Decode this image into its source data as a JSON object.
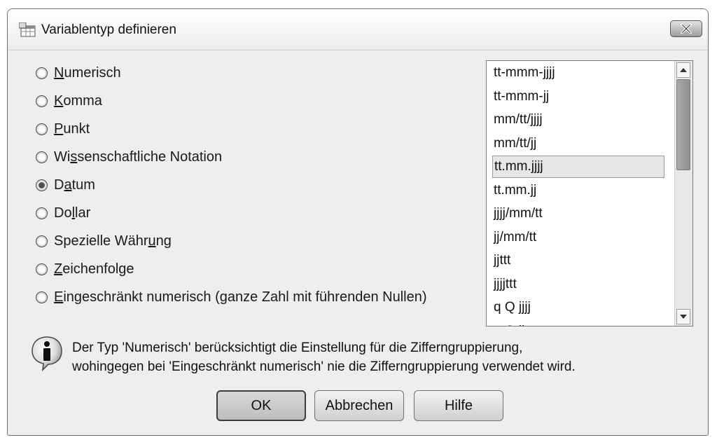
{
  "window": {
    "title": "Variablentyp definieren",
    "icon": "variable-type-icon"
  },
  "types": [
    {
      "label": "Numerisch",
      "mnemonic": "N",
      "checked": false
    },
    {
      "label": "Komma",
      "mnemonic": "K",
      "checked": false
    },
    {
      "label": "Punkt",
      "mnemonic": "P",
      "checked": false
    },
    {
      "label": "Wissenschaftliche Notation",
      "mnemonic": "s",
      "checked": false
    },
    {
      "label": "Datum",
      "mnemonic": "a",
      "checked": true
    },
    {
      "label": "Dollar",
      "mnemonic": "l",
      "checked": false
    },
    {
      "label": "Spezielle Währung",
      "mnemonic": "u",
      "checked": false
    },
    {
      "label": "Zeichenfolge",
      "mnemonic": "Z",
      "checked": false
    },
    {
      "label": "Eingeschränkt numerisch (ganze Zahl mit führenden Nullen)",
      "mnemonic": "E",
      "checked": false
    }
  ],
  "date_formats": {
    "items": [
      "tt-mmm-jjjj",
      "tt-mmm-jj",
      "mm/tt/jjjj",
      "mm/tt/jj",
      "tt.mm.jjjj",
      "tt.mm.jj",
      "jjjj/mm/tt",
      "jj/mm/tt",
      "jjttt",
      "jjjjttt",
      "q Q jjjj",
      "q Q jj"
    ],
    "selected_index": 4
  },
  "info": {
    "icon": "info-icon",
    "line1": "Der Typ 'Numerisch' berücksichtigt die Einstellung für die Zifferngruppierung,",
    "line2": "wohingegen bei 'Eingeschränkt numerisch' nie die Zifferngruppierung verwendet wird."
  },
  "buttons": {
    "ok": "OK",
    "cancel": "Abbrechen",
    "help": "Hilfe"
  },
  "colors": {
    "dialog_bg": "#eeeeee",
    "selection_bg": "#e6e6e6",
    "scroll_thumb": "#999999"
  }
}
